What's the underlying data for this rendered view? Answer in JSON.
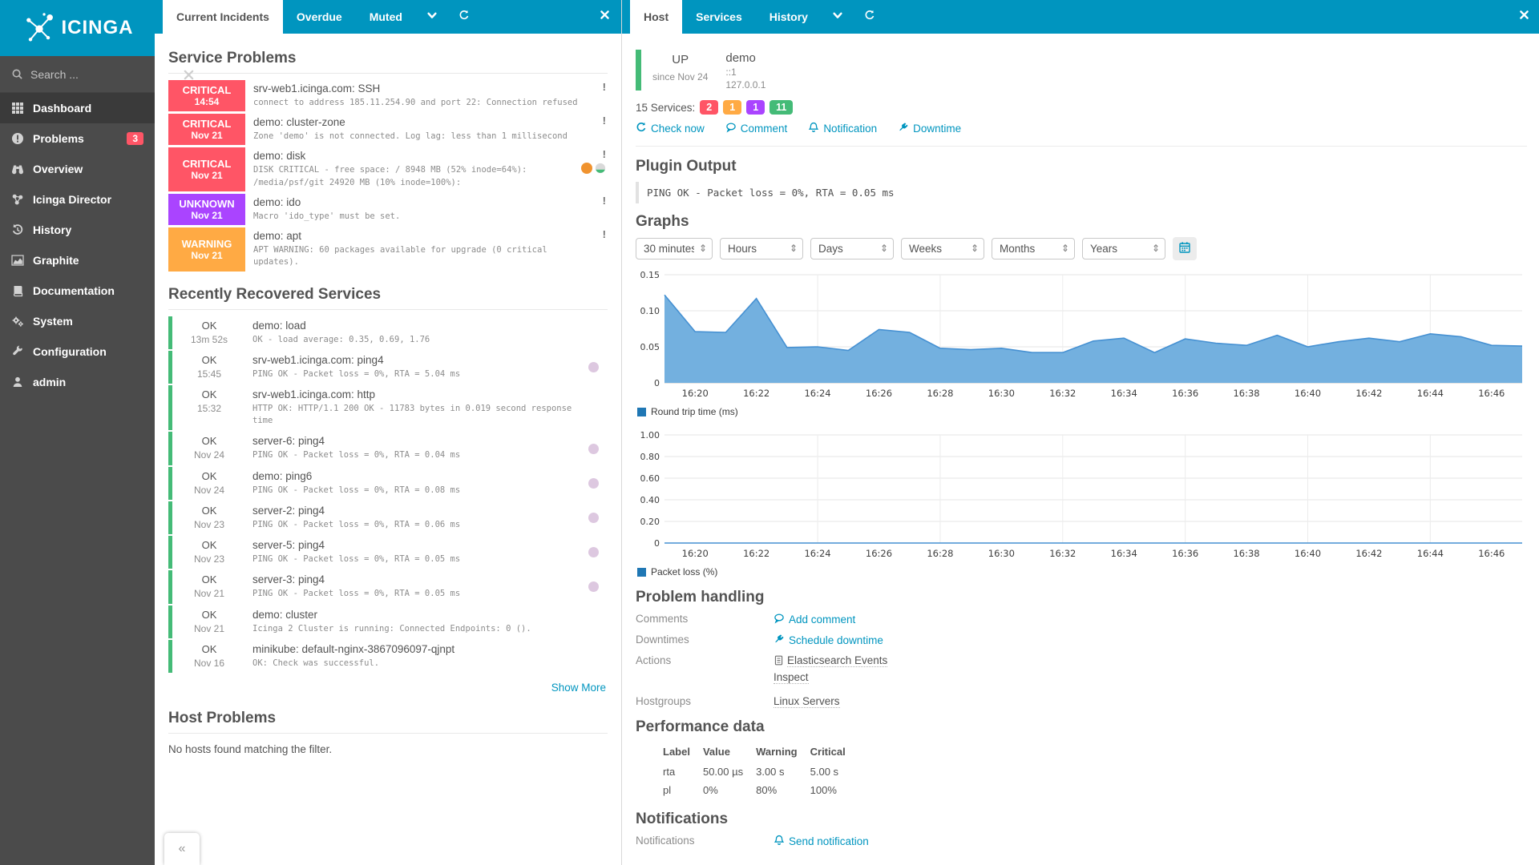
{
  "colors": {
    "brand": "#0095bf",
    "critical": "#ff5566",
    "warning": "#ffaa44",
    "unknown": "#aa44ff",
    "ok": "#44bb77",
    "chart_fill": "#73b0df",
    "chart_stroke": "#4590d2",
    "legend_swatch": "#1f77b4"
  },
  "sidebar": {
    "logo_text": "ICINGA",
    "search": {
      "placeholder": "Search ..."
    },
    "items": [
      {
        "label": "Dashboard",
        "icon": "grid-icon",
        "active": true
      },
      {
        "label": "Problems",
        "icon": "exclaim-circle-icon",
        "badge": "3"
      },
      {
        "label": "Overview",
        "icon": "binoculars-icon"
      },
      {
        "label": "Icinga Director",
        "icon": "director-icon"
      },
      {
        "label": "History",
        "icon": "history-icon"
      },
      {
        "label": "Graphite",
        "icon": "chart-area-icon"
      },
      {
        "label": "Documentation",
        "icon": "book-icon"
      },
      {
        "label": "System",
        "icon": "gears-icon"
      },
      {
        "label": "Configuration",
        "icon": "wrench-icon"
      },
      {
        "label": "admin",
        "icon": "user-icon"
      }
    ],
    "collapse_label": "«"
  },
  "middle": {
    "tabs": [
      {
        "label": "Current Incidents",
        "active": true
      },
      {
        "label": "Overdue",
        "active": false
      },
      {
        "label": "Muted",
        "active": false
      }
    ],
    "service_problems": {
      "title": "Service Problems",
      "rows": [
        {
          "state": "CRITICAL",
          "time": "14:54",
          "state_key": "critical",
          "name": "srv-web1.icinga.com: SSH",
          "output": "connect to address 185.11.254.90 and port 22: Connection refused",
          "has_perf_icons": false
        },
        {
          "state": "CRITICAL",
          "time": "Nov 21",
          "state_key": "critical",
          "name": "demo: cluster-zone",
          "output": "Zone 'demo' is not connected. Log lag: less than 1 millisecond",
          "has_perf_icons": false
        },
        {
          "state": "CRITICAL",
          "time": "Nov 21",
          "state_key": "critical",
          "name": "demo: disk",
          "output": "DISK CRITICAL - free space: / 8948 MB (52% inode=64%): /media/psf/git 24920 MB (10% inode=100%):",
          "has_perf_icons": true
        },
        {
          "state": "UNKNOWN",
          "time": "Nov 21",
          "state_key": "unknown",
          "name": "demo: ido",
          "output": "Macro 'ido_type' must be set.",
          "has_perf_icons": false
        },
        {
          "state": "WARNING",
          "time": "Nov 21",
          "state_key": "warning",
          "name": "demo: apt",
          "output": "APT WARNING: 60 packages available for upgrade (0 critical updates).",
          "has_perf_icons": false
        }
      ]
    },
    "recovered": {
      "title": "Recently Recovered Services",
      "rows": [
        {
          "state": "OK",
          "time": "13m 52s",
          "name": "demo: load",
          "output": "OK - load average: 0.35, 0.69, 1.76",
          "has_dot": false
        },
        {
          "state": "OK",
          "time": "15:45",
          "name": "srv-web1.icinga.com: ping4",
          "output": "PING OK - Packet loss = 0%, RTA = 5.04 ms",
          "has_dot": true
        },
        {
          "state": "OK",
          "time": "15:32",
          "name": "srv-web1.icinga.com: http",
          "output": "HTTP OK: HTTP/1.1 200 OK - 11783 bytes in 0.019 second response time",
          "has_dot": false
        },
        {
          "state": "OK",
          "time": "Nov 24",
          "name": "server-6: ping4",
          "output": "PING OK - Packet loss = 0%, RTA = 0.04 ms",
          "has_dot": true
        },
        {
          "state": "OK",
          "time": "Nov 24",
          "name": "demo: ping6",
          "output": "PING OK - Packet loss = 0%, RTA = 0.08 ms",
          "has_dot": true
        },
        {
          "state": "OK",
          "time": "Nov 23",
          "name": "server-2: ping4",
          "output": "PING OK - Packet loss = 0%, RTA = 0.06 ms",
          "has_dot": true
        },
        {
          "state": "OK",
          "time": "Nov 23",
          "name": "server-5: ping4",
          "output": "PING OK - Packet loss = 0%, RTA = 0.05 ms",
          "has_dot": true
        },
        {
          "state": "OK",
          "time": "Nov 21",
          "name": "server-3: ping4",
          "output": "PING OK - Packet loss = 0%, RTA = 0.05 ms",
          "has_dot": true
        },
        {
          "state": "OK",
          "time": "Nov 21",
          "name": "demo: cluster",
          "output": "Icinga 2 Cluster is running: Connected Endpoints: 0 ().",
          "has_dot": false
        },
        {
          "state": "OK",
          "time": "Nov 16",
          "name": "minikube: default-nginx-3867096097-qjnpt",
          "output": "OK: Check was successful.",
          "has_dot": false
        }
      ],
      "show_more": "Show More"
    },
    "host_problems": {
      "title": "Host Problems",
      "empty": "No hosts found matching the filter."
    }
  },
  "right": {
    "tabs": [
      {
        "label": "Host",
        "active": true
      },
      {
        "label": "Services",
        "active": false
      },
      {
        "label": "History",
        "active": false
      }
    ],
    "host": {
      "state": "UP",
      "since": "since Nov 24",
      "name": "demo",
      "address6": "::1",
      "address4": "127.0.0.1"
    },
    "services_summary": {
      "label": "15 Services:",
      "badges": [
        {
          "count": "2",
          "state_key": "critical"
        },
        {
          "count": "1",
          "state_key": "warning"
        },
        {
          "count": "1",
          "state_key": "unknown"
        },
        {
          "count": "11",
          "state_key": "ok"
        }
      ]
    },
    "actions": [
      {
        "label": "Check now",
        "icon": "refresh-icon"
      },
      {
        "label": "Comment",
        "icon": "comment-icon"
      },
      {
        "label": "Notification",
        "icon": "bell-icon"
      },
      {
        "label": "Downtime",
        "icon": "plug-icon"
      }
    ],
    "plugin_output": {
      "title": "Plugin Output",
      "text": "PING OK - Packet loss = 0%, RTA = 0.05 ms"
    },
    "graphs": {
      "title": "Graphs",
      "ranges": [
        "30 minutes",
        "Hours",
        "Days",
        "Weeks",
        "Months",
        "Years"
      ]
    },
    "problem_handling": {
      "title": "Problem handling",
      "comments_label": "Comments",
      "add_comment": "Add comment",
      "downtimes_label": "Downtimes",
      "schedule_downtime": "Schedule downtime",
      "actions_label": "Actions",
      "action_links": [
        "Elasticsearch Events",
        "Inspect"
      ],
      "hostgroups_label": "Hostgroups",
      "hostgroup_link": "Linux Servers"
    },
    "performance": {
      "title": "Performance data",
      "headers": [
        "Label",
        "Value",
        "Warning",
        "Critical"
      ],
      "rows": [
        {
          "dot": false,
          "label": "rta",
          "value": "50.00 µs",
          "warning": "3.00 s",
          "critical": "5.00 s"
        },
        {
          "dot": true,
          "label": "pl",
          "value": "0%",
          "warning": "80%",
          "critical": "100%"
        }
      ]
    },
    "notifications": {
      "title": "Notifications",
      "label": "Notifications",
      "send": "Send notification"
    }
  },
  "chart_data": [
    {
      "type": "area",
      "legend": "Round trip time (ms)",
      "x_labels": [
        "16:20",
        "16:22",
        "16:24",
        "16:26",
        "16:28",
        "16:30",
        "16:32",
        "16:34",
        "16:36",
        "16:38",
        "16:40",
        "16:42",
        "16:44",
        "16:46"
      ],
      "x_start": "16:19",
      "x_step_minutes": 1,
      "ylim": [
        0,
        0.15
      ],
      "yticks": [
        0,
        0.05,
        0.1,
        0.15
      ],
      "values": [
        0.122,
        0.071,
        0.07,
        0.117,
        0.049,
        0.05,
        0.045,
        0.074,
        0.07,
        0.048,
        0.046,
        0.048,
        0.042,
        0.042,
        0.058,
        0.062,
        0.042,
        0.061,
        0.055,
        0.052,
        0.066,
        0.05,
        0.057,
        0.062,
        0.057,
        0.068,
        0.064,
        0.052,
        0.051
      ]
    },
    {
      "type": "area",
      "legend": "Packet loss (%)",
      "x_labels": [
        "16:20",
        "16:22",
        "16:24",
        "16:26",
        "16:28",
        "16:30",
        "16:32",
        "16:34",
        "16:36",
        "16:38",
        "16:40",
        "16:42",
        "16:44",
        "16:46"
      ],
      "x_start": "16:19",
      "x_step_minutes": 1,
      "ylim": [
        0,
        1.0
      ],
      "yticks": [
        0,
        0.2,
        0.4,
        0.6,
        0.8,
        1.0
      ],
      "values": [
        0,
        0,
        0,
        0,
        0,
        0,
        0,
        0,
        0,
        0,
        0,
        0,
        0,
        0,
        0,
        0,
        0,
        0,
        0,
        0,
        0,
        0,
        0,
        0,
        0,
        0,
        0,
        0,
        0
      ]
    }
  ]
}
